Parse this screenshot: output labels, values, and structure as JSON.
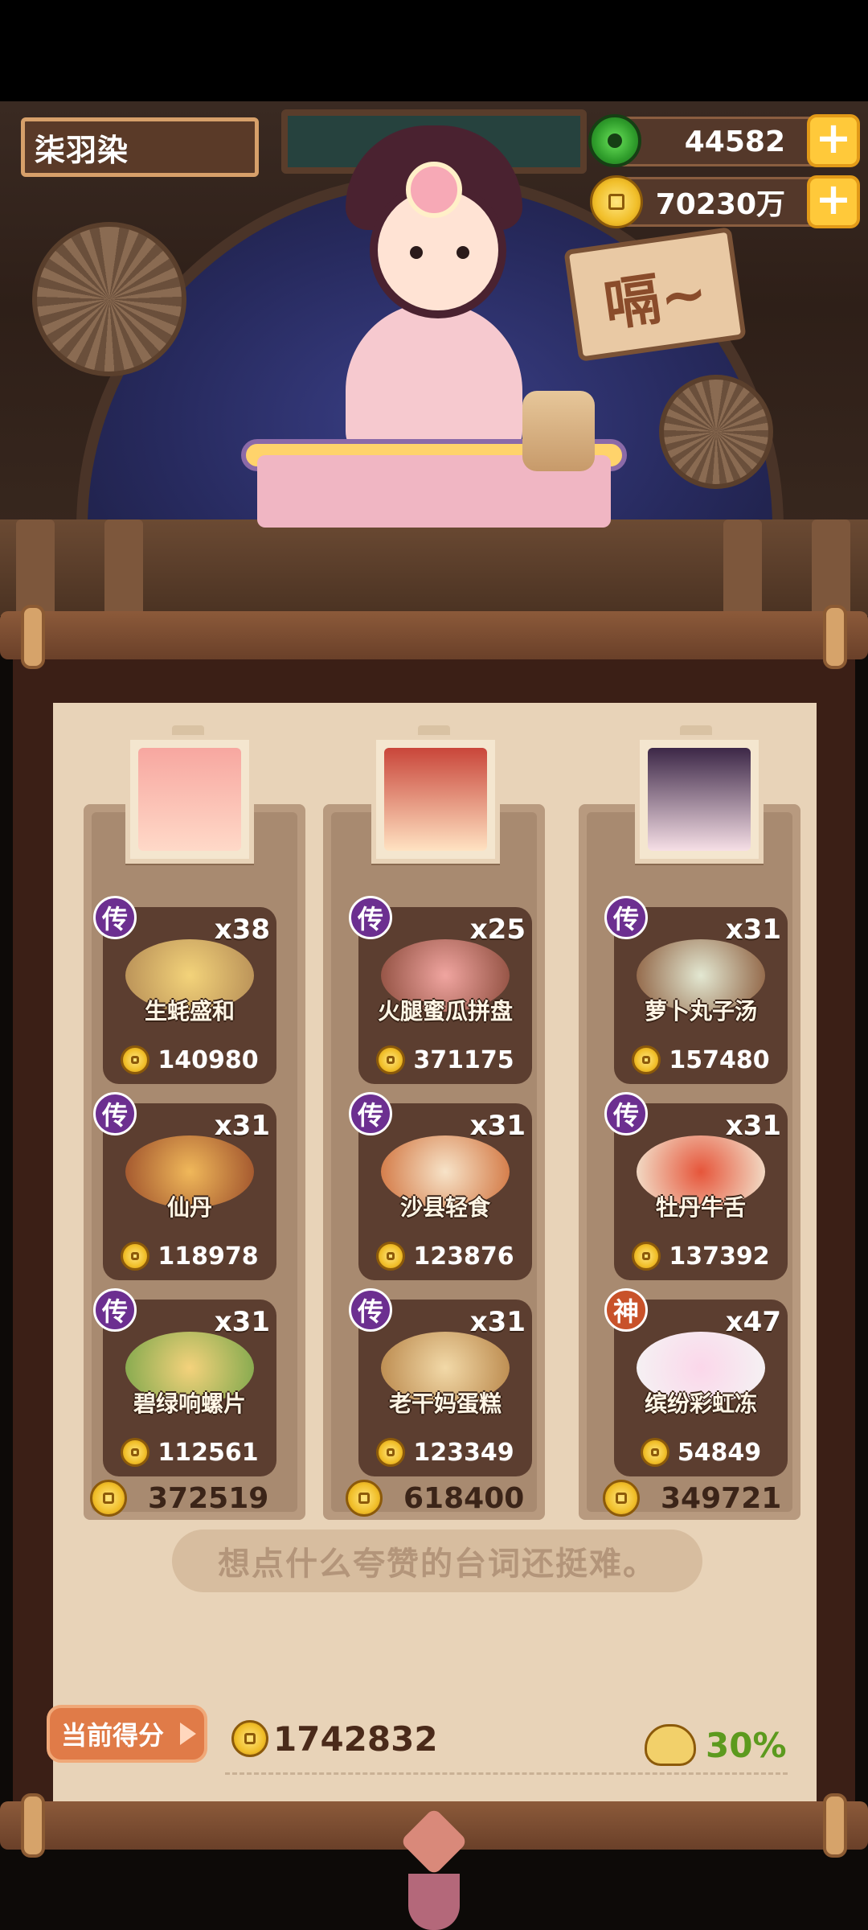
{
  "player": {
    "name": "柒羽染"
  },
  "resources": {
    "jade": "44582",
    "coins": "70230万",
    "plus_symbol": "+"
  },
  "scene": {
    "sticker_text": "嗝~"
  },
  "columns": [
    {
      "total": "372519",
      "dishes": [
        {
          "badge": "传",
          "qty": "x38",
          "name": "生蚝盛和",
          "price": "140980"
        },
        {
          "badge": "传",
          "qty": "x31",
          "name": "仙丹",
          "price": "118978"
        },
        {
          "badge": "传",
          "qty": "x31",
          "name": "碧绿响螺片",
          "price": "112561"
        }
      ]
    },
    {
      "total": "618400",
      "dishes": [
        {
          "badge": "传",
          "qty": "x25",
          "name": "火腿蜜瓜拼盘",
          "price": "371175"
        },
        {
          "badge": "传",
          "qty": "x31",
          "name": "沙县轻食",
          "price": "123876"
        },
        {
          "badge": "传",
          "qty": "x31",
          "name": "老干妈蛋糕",
          "price": "123349"
        }
      ]
    },
    {
      "total": "349721",
      "dishes": [
        {
          "badge": "传",
          "qty": "x31",
          "name": "萝卜丸子汤",
          "price": "157480"
        },
        {
          "badge": "传",
          "qty": "x31",
          "name": "牡丹牛舌",
          "price": "137392"
        },
        {
          "badge": "神",
          "qty": "x47",
          "name": "缤纷彩虹冻",
          "price": "54849"
        }
      ]
    }
  ],
  "quote": "想点什么夸赞的台词还挺难。",
  "score": {
    "label": "当前得分",
    "value": "1742832",
    "percent": "30%"
  },
  "colors": {
    "legend_badge": "#6c2f90",
    "divine_badge": "#c8522a",
    "percent_green": "#5c9a1e"
  }
}
